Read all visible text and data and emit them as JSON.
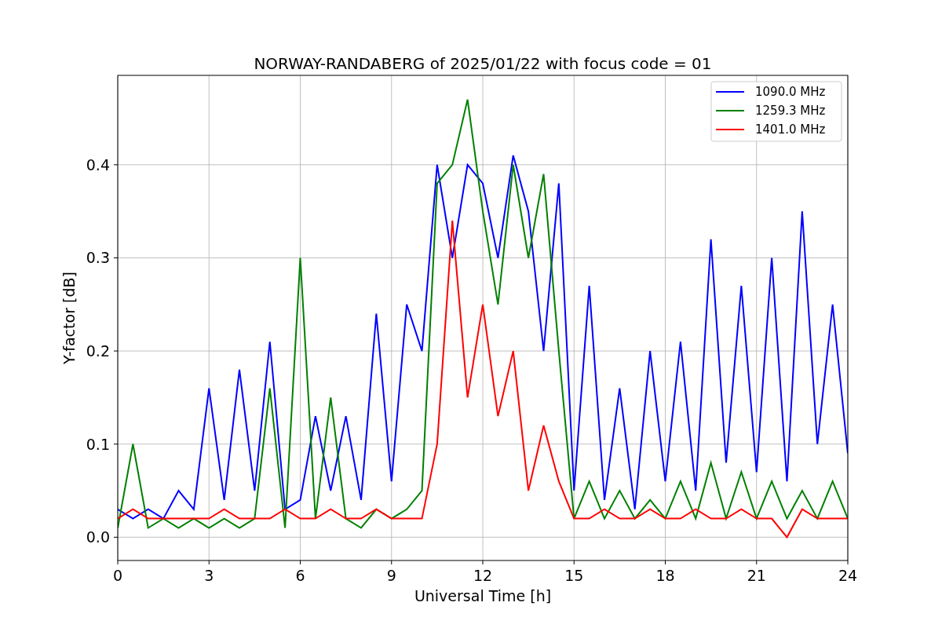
{
  "chart_data": {
    "type": "line",
    "title": "NORWAY-RANDABERG of 2025/01/22 with focus code = 01",
    "xlabel": "Universal Time [h]",
    "ylabel": "Y-factor [dB]",
    "x": [
      0,
      0.5,
      1,
      1.5,
      2,
      2.5,
      3,
      3.5,
      4,
      4.5,
      5,
      5.5,
      6,
      6.5,
      7,
      7.5,
      8,
      8.5,
      9,
      9.5,
      10,
      10.5,
      11,
      11.5,
      12,
      12.5,
      13,
      13.5,
      14,
      14.5,
      15,
      15.5,
      16,
      16.5,
      17,
      17.5,
      18,
      18.5,
      19,
      19.5,
      20,
      20.5,
      21,
      21.5,
      22,
      22.5,
      23,
      23.5,
      24
    ],
    "xlim": [
      0,
      24
    ],
    "ylim": [
      -0.025,
      0.496
    ],
    "grid": true,
    "legend": true,
    "xticks": [
      0,
      3,
      6,
      9,
      12,
      15,
      18,
      21,
      24
    ],
    "yticks": [
      {
        "value": 0,
        "label": "0.0"
      },
      {
        "value": 0.1,
        "label": "0.1"
      },
      {
        "value": 0.2,
        "label": "0.2"
      },
      {
        "value": 0.3,
        "label": "0.3"
      },
      {
        "value": 0.4,
        "label": "0.4"
      }
    ],
    "series": [
      {
        "name": "1090.0 MHz",
        "color": "#0000ff",
        "values": [
          0.03,
          0.02,
          0.03,
          0.02,
          0.05,
          0.03,
          0.16,
          0.04,
          0.18,
          0.05,
          0.21,
          0.03,
          0.04,
          0.13,
          0.05,
          0.13,
          0.04,
          0.24,
          0.06,
          0.25,
          0.2,
          0.4,
          0.3,
          0.4,
          0.38,
          0.3,
          0.41,
          0.35,
          0.2,
          0.38,
          0.05,
          0.27,
          0.04,
          0.16,
          0.03,
          0.2,
          0.06,
          0.21,
          0.05,
          0.32,
          0.08,
          0.27,
          0.07,
          0.3,
          0.06,
          0.35,
          0.1,
          0.25,
          0.09
        ]
      },
      {
        "name": "1259.3 MHz",
        "color": "#008000",
        "values": [
          0.01,
          0.1,
          0.01,
          0.02,
          0.01,
          0.02,
          0.01,
          0.02,
          0.01,
          0.02,
          0.16,
          0.01,
          0.3,
          0.02,
          0.15,
          0.02,
          0.01,
          0.03,
          0.02,
          0.03,
          0.05,
          0.38,
          0.4,
          0.47,
          0.35,
          0.25,
          0.4,
          0.3,
          0.39,
          0.2,
          0.02,
          0.06,
          0.02,
          0.05,
          0.02,
          0.04,
          0.02,
          0.06,
          0.02,
          0.08,
          0.02,
          0.07,
          0.02,
          0.06,
          0.02,
          0.05,
          0.02,
          0.06,
          0.02
        ]
      },
      {
        "name": "1401.0 MHz",
        "color": "#ff0000",
        "values": [
          0.02,
          0.03,
          0.02,
          0.02,
          0.02,
          0.02,
          0.02,
          0.03,
          0.02,
          0.02,
          0.02,
          0.03,
          0.02,
          0.02,
          0.03,
          0.02,
          0.02,
          0.03,
          0.02,
          0.02,
          0.02,
          0.1,
          0.34,
          0.15,
          0.25,
          0.13,
          0.2,
          0.05,
          0.12,
          0.06,
          0.02,
          0.02,
          0.03,
          0.02,
          0.02,
          0.03,
          0.02,
          0.02,
          0.03,
          0.02,
          0.02,
          0.03,
          0.02,
          0.02,
          0,
          0.03,
          0.02,
          0.02,
          0.02
        ]
      }
    ]
  }
}
